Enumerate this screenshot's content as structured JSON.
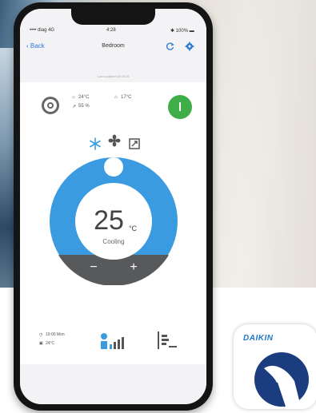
{
  "status_bar": {
    "carrier": "•••• diag  4G",
    "time": "4:28",
    "battery": "✱ 100% ▬"
  },
  "nav": {
    "back_label": "‹ Back",
    "title": "Bedroom",
    "icons": [
      "refresh-icon",
      "settings-icon"
    ]
  },
  "subtitle": "Last updated 15:05:18",
  "status": {
    "indoor_temp": "24°C",
    "outdoor_temp": "17°C",
    "humidity": "55 %"
  },
  "mode_icons": [
    "snowflake-icon",
    "fan-icon",
    "swing-icon"
  ],
  "dial": {
    "temperature": "25",
    "unit": "°C",
    "mode": "Cooling",
    "minus": "−",
    "plus": "+",
    "accent": "#3b9be0",
    "level": 0.45
  },
  "bottom": {
    "schedule_time": "19:00 Mon",
    "schedule_temp": "24°C",
    "icons": [
      "fan-speed-icon",
      "consumption-icon"
    ]
  },
  "app": {
    "brand": "DAIKIN",
    "brand_color": "#1e78c8",
    "logo_color": "#1b3d7f"
  }
}
